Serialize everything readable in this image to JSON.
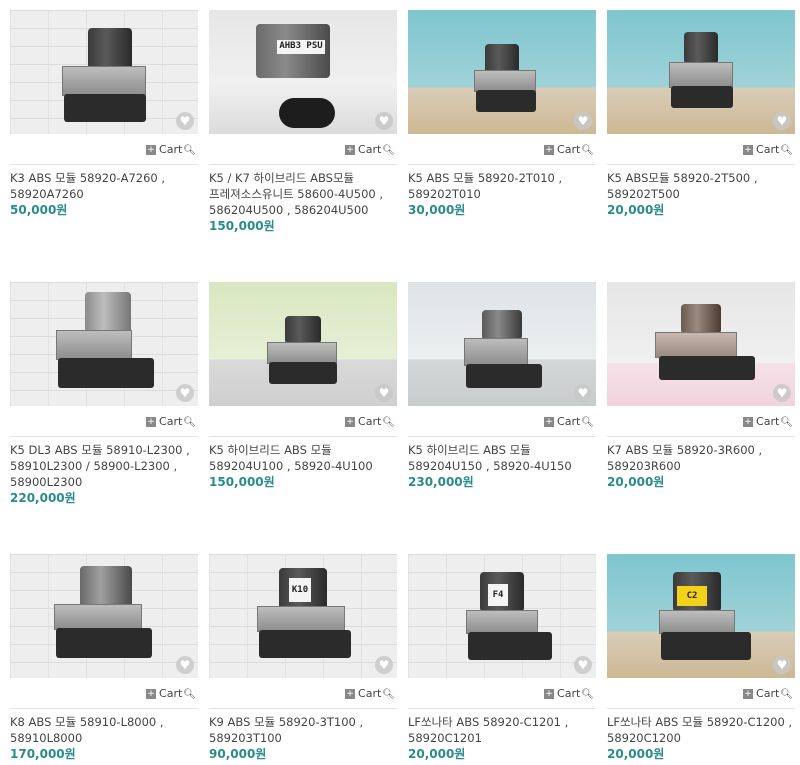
{
  "cart_label": "Cart",
  "colors": {
    "price": "#2a8b8b",
    "favorite_bg": "#c8c8c8"
  },
  "products": [
    {
      "title": "K3 ABS 모듈 58920-A7260 , 58920A7260",
      "price": "50,000원",
      "sticker": ""
    },
    {
      "title": "K5 / K7 하이브리드 ABS모듈 프레져소스유니트 58600-4U500 , 586204U500 , 586204U500",
      "price": "150,000원",
      "sticker": "AHB3 PSU"
    },
    {
      "title": "K5 ABS 모듈 58920-2T010 , 589202T010",
      "price": "30,000원",
      "sticker": ""
    },
    {
      "title": "K5 ABS모듈 58920-2T500 , 589202T500",
      "price": "20,000원",
      "sticker": ""
    },
    {
      "title": "K5 DL3 ABS 모듈 58910-L2300 , 58910L2300 / 58900-L2300 , 58900L2300",
      "price": "220,000원",
      "sticker": ""
    },
    {
      "title": "K5 하이브리드 ABS 모듈 589204U100 , 58920-4U100",
      "price": "150,000원",
      "sticker": ""
    },
    {
      "title": "K5 하이브리드 ABS 모듈 589204U150 , 58920-4U150",
      "price": "230,000원",
      "sticker": ""
    },
    {
      "title": "K7 ABS 모듈 58920-3R600 , 589203R600",
      "price": "20,000원",
      "sticker": ""
    },
    {
      "title": "K8 ABS 모듈 58910-L8000 , 58910L8000",
      "price": "170,000원",
      "sticker": ""
    },
    {
      "title": "K9 ABS 모듈 58920-3T100 , 589203T100",
      "price": "90,000원",
      "sticker": "K10"
    },
    {
      "title": "LF쏘나타 ABS 58920-C1201 , 58920C1201",
      "price": "20,000원",
      "sticker": "F4"
    },
    {
      "title": "LF쏘나타 ABS 모듈 58920-C1200 , 58920C1200",
      "price": "20,000원",
      "sticker": "C2"
    }
  ]
}
